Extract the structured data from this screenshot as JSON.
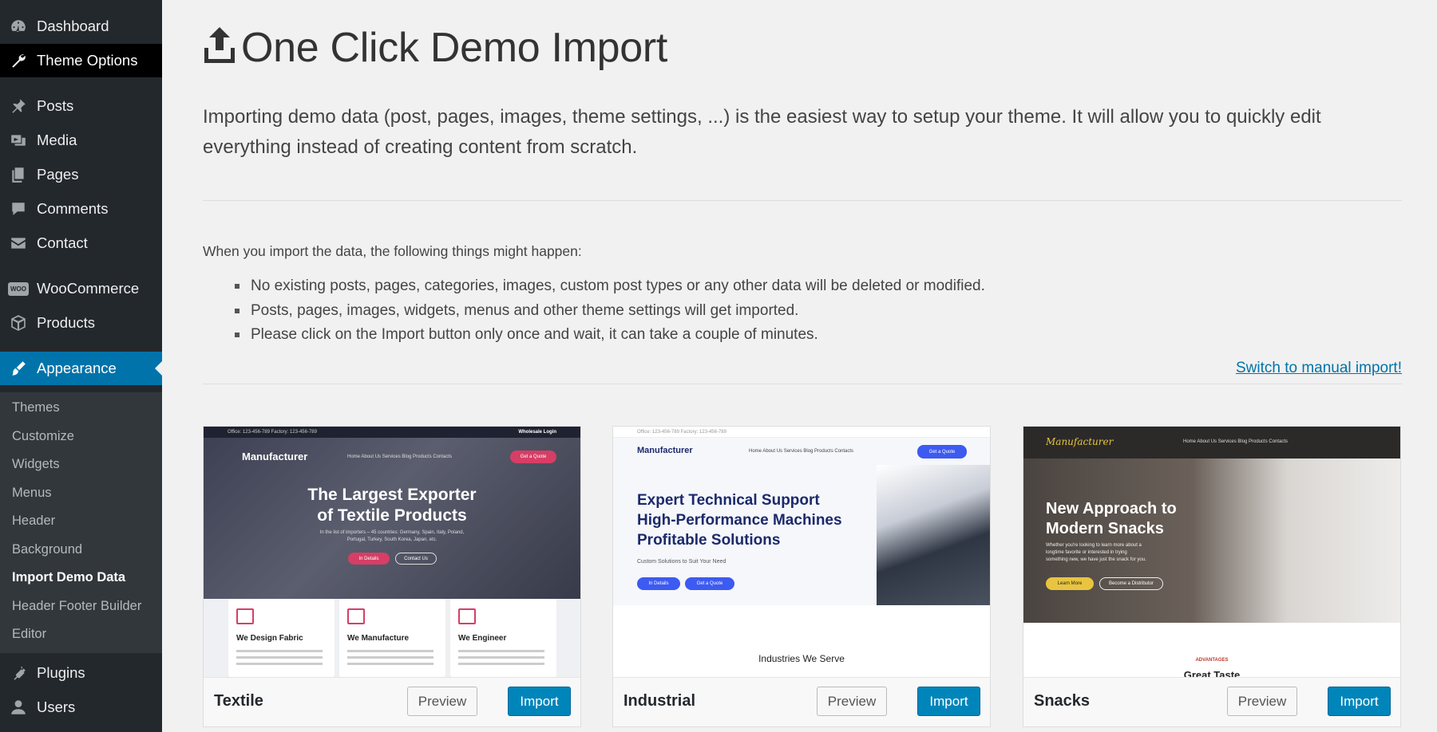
{
  "sidebar": {
    "items": [
      {
        "label": "Dashboard",
        "icon": "dashboard-icon"
      },
      {
        "label": "Theme Options",
        "icon": "wrench-icon"
      },
      {
        "label": "Posts",
        "icon": "pin-icon"
      },
      {
        "label": "Media",
        "icon": "media-icon"
      },
      {
        "label": "Pages",
        "icon": "pages-icon"
      },
      {
        "label": "Comments",
        "icon": "comment-icon"
      },
      {
        "label": "Contact",
        "icon": "envelope-icon"
      },
      {
        "label": "WooCommerce",
        "icon": "woo-icon",
        "icon_text": "WOO"
      },
      {
        "label": "Products",
        "icon": "box-icon"
      },
      {
        "label": "Appearance",
        "icon": "brush-icon"
      }
    ],
    "submenu": [
      "Themes",
      "Customize",
      "Widgets",
      "Menus",
      "Header",
      "Background",
      "Import Demo Data",
      "Header Footer Builder",
      "Editor"
    ],
    "bottom_items": [
      {
        "label": "Plugins",
        "icon": "plug-icon"
      },
      {
        "label": "Users",
        "icon": "user-icon"
      }
    ]
  },
  "main": {
    "title": "One Click Demo Import",
    "intro": "Importing demo data (post, pages, images, theme settings, ...) is the easiest way to setup your theme. It will allow you to quickly edit everything instead of creating content from scratch.",
    "lead": "When you import the data, the following things might happen:",
    "notes": [
      "No existing posts, pages, categories, images, custom post types or any other data will be deleted or modified.",
      "Posts, pages, images, widgets, menus and other theme settings will get imported.",
      "Please click on the Import button only once and wait, it can take a couple of minutes."
    ],
    "manual_link": "Switch to manual import!"
  },
  "demos": [
    {
      "name": "Textile",
      "preview_label": "Preview",
      "import_label": "Import",
      "shot": {
        "top_left": "Office: 123-456-789       Factory: 123-456-789",
        "top_right": "Wholesale Login",
        "logo": "Manufacturer",
        "nav": "Home   About Us   Services   Blog   Products   Contacts",
        "cta": "Get a Quote",
        "hero_line1": "The Largest Exporter",
        "hero_line2": "of Textile Products",
        "hero_sub": "In the list of importers – 45 countries: Germany, Spain, Italy, Poland,",
        "hero_sub2": "Portugal, Turkey, South Korea, Japan, etc.",
        "btn1": "In Details",
        "btn2": "Contact Us",
        "cards": [
          "We Design Fabric",
          "We Manufacture",
          "We Engineer"
        ]
      }
    },
    {
      "name": "Industrial",
      "preview_label": "Preview",
      "import_label": "Import",
      "shot": {
        "top_left": "Office: 123-456-789    Factory: 123-456-789",
        "logo": "Manufacturer",
        "nav": "Home   About Us   Services   Blog   Products   Contacts",
        "cta": "Get a Quote",
        "hero_line1": "Expert Technical Support",
        "hero_line2": "High-Performance Machines",
        "hero_line3": "Profitable Solutions",
        "hero_sub": "Custom Solutions to Suit Your Need",
        "btn1": "In Details",
        "btn2": "Get a Quote",
        "section": "Industries We Serve"
      }
    },
    {
      "name": "Snacks",
      "preview_label": "Preview",
      "import_label": "Import",
      "shot": {
        "logo": "Manufacturer",
        "nav": "Home   About Us   Services   Blog   Products   Contacts",
        "hero_line1": "New Approach to",
        "hero_line2": "Modern Snacks",
        "hero_sub": "Whether you're looking to learn more about a",
        "hero_sub2": "longtime favorite or interested in trying",
        "hero_sub3": "something new, we have just the snack for you.",
        "btn1": "Learn More",
        "btn2": "Become a Distributor",
        "kicker": "ADVANTAGES",
        "section": "Great Taste"
      }
    }
  ],
  "colors": {
    "sidebar_bg": "#23282d",
    "submenu_bg": "#32373c",
    "active_bg": "#0073aa",
    "import_button": "#0085ba",
    "link": "#0073aa"
  }
}
